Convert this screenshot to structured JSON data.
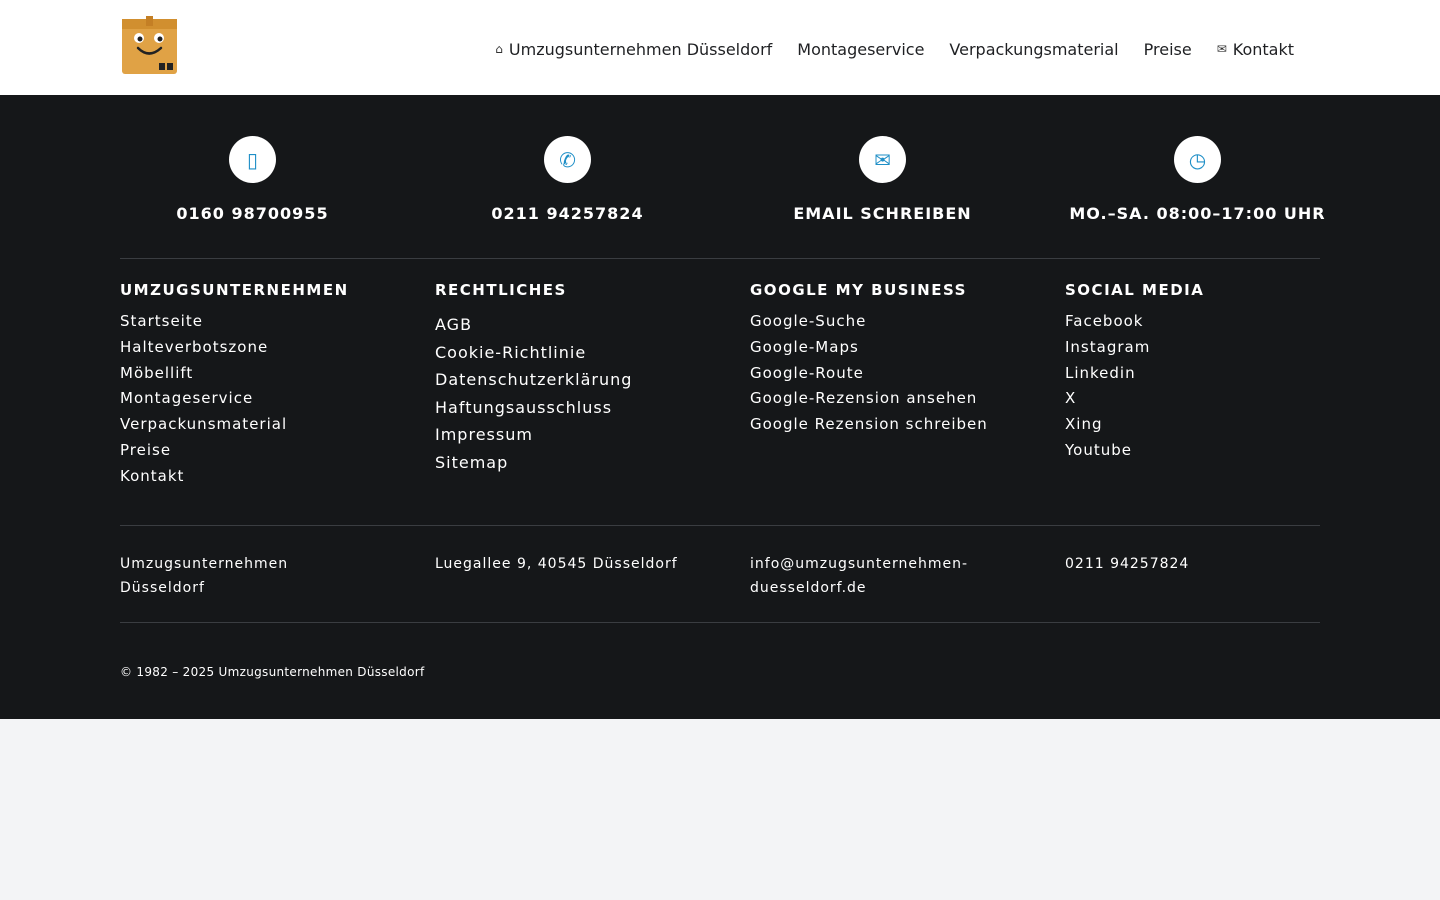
{
  "header": {
    "nav": [
      {
        "label": "Umzugsunternehmen Düsseldorf",
        "icon": "home-icon"
      },
      {
        "label": "Montageservice"
      },
      {
        "label": "Verpackungsmaterial"
      },
      {
        "label": "Preise"
      },
      {
        "label": "Kontakt",
        "icon": "envelope-icon"
      }
    ]
  },
  "contacts": [
    {
      "label": "0160 98700955",
      "icon": "mobile-phone-icon"
    },
    {
      "label": "0211 94257824",
      "icon": "phone-icon"
    },
    {
      "label": "EMAIL SCHREIBEN",
      "icon": "envelope-icon"
    },
    {
      "label": "MO.–SA. 08:00–17:00 UHR",
      "icon": "clock-icon"
    }
  ],
  "columns": [
    {
      "title": "UMZUGSUNTERNEHMEN",
      "items": [
        "Startseite",
        "Halteverbotszone",
        "Möbellift",
        "Montageservice",
        "Verpackunsmaterial",
        "Preise",
        "Kontakt"
      ]
    },
    {
      "title": "RECHTLICHES",
      "items": [
        "AGB",
        "Cookie-Richtlinie",
        "Datenschutzerklärung",
        "Haftungsausschluss",
        "Impressum",
        "Sitemap"
      ]
    },
    {
      "title": "GOOGLE MY BUSINESS",
      "items": [
        "Google-Suche",
        "Google-Maps",
        "Google-Route",
        "Google-Rezension ansehen",
        "Google Rezension schreiben"
      ]
    },
    {
      "title": "SOCIAL MEDIA",
      "items": [
        "Facebook",
        "Instagram",
        "Linkedin",
        "X",
        "Xing",
        "Youtube"
      ]
    }
  ],
  "info": {
    "company_line1": "Umzugsunternehmen",
    "company_line2": "Düsseldorf",
    "address": "Luegallee 9, 40545 Düsseldorf",
    "email_line1": "info@umzugsunternehmen-",
    "email_line2": "duesseldorf.de",
    "phone": "0211 94257824"
  },
  "copyright": "© 1982 – 2025 Umzugsunternehmen Düsseldorf",
  "colors": {
    "footer_bg": "#151719",
    "accent": "#1f8fc7",
    "header_bg": "#ffffff",
    "page_bg": "#f3f4f6"
  }
}
